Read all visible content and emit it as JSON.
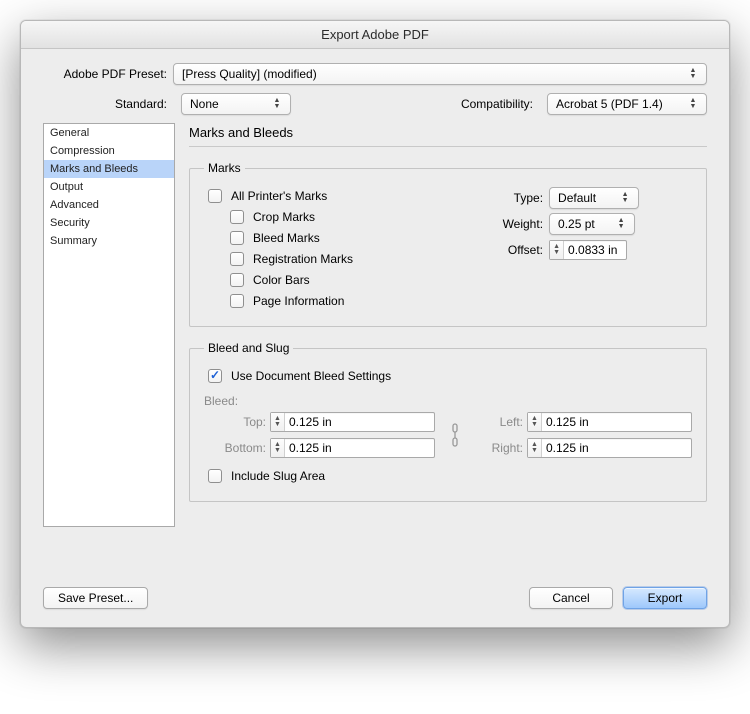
{
  "window": {
    "title": "Export Adobe PDF"
  },
  "preset": {
    "label": "Adobe PDF Preset:",
    "value": "[Press Quality] (modified)"
  },
  "standard": {
    "label": "Standard:",
    "value": "None"
  },
  "compatibility": {
    "label": "Compatibility:",
    "value": "Acrobat 5 (PDF 1.4)"
  },
  "sidebar": {
    "items": [
      "General",
      "Compression",
      "Marks and Bleeds",
      "Output",
      "Advanced",
      "Security",
      "Summary"
    ],
    "selected_index": 2
  },
  "section": {
    "title": "Marks and Bleeds"
  },
  "marks": {
    "legend": "Marks",
    "all": "All Printer's Marks",
    "crop": "Crop Marks",
    "bleed": "Bleed Marks",
    "registration": "Registration Marks",
    "colorbars": "Color Bars",
    "pageinfo": "Page Information",
    "type_label": "Type:",
    "type_value": "Default",
    "weight_label": "Weight:",
    "weight_value": "0.25 pt",
    "offset_label": "Offset:",
    "offset_value": "0.0833 in"
  },
  "bleedslug": {
    "legend": "Bleed and Slug",
    "use_doc": "Use Document Bleed Settings",
    "bleed_heading": "Bleed:",
    "top_label": "Top:",
    "bottom_label": "Bottom:",
    "left_label": "Left:",
    "right_label": "Right:",
    "top_value": "0.125 in",
    "bottom_value": "0.125 in",
    "left_value": "0.125 in",
    "right_value": "0.125 in",
    "include_slug": "Include Slug Area"
  },
  "footer": {
    "save_preset": "Save Preset...",
    "cancel": "Cancel",
    "export": "Export"
  }
}
